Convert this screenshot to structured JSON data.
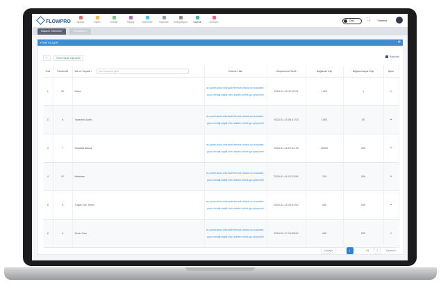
{
  "app": {
    "logo": "FLOWPRO"
  },
  "nav": {
    "items": [
      {
        "label": "Ayarlar",
        "color": "#e57373"
      },
      {
        "label": "Kişiler",
        "color": "#ffb74d"
      },
      {
        "label": "Ürünler",
        "color": "#81c784"
      },
      {
        "label": "Sipariş",
        "color": "#ba68c8"
      },
      {
        "label": "Ödemeler",
        "color": "#4fc3f7"
      },
      {
        "label": "Raporlar",
        "color": "#90a4ae"
      },
      {
        "label": "Entegrasyon",
        "color": "#a1887f"
      },
      {
        "label": "Kuyruk",
        "color": "#4db6ac"
      },
      {
        "label": "Dil Ayarı",
        "color": "#f06292"
      }
    ]
  },
  "header": {
    "toggle_label": "Dark",
    "user_name": "Yönetici"
  },
  "tabs": [
    {
      "label": "Başarılı Ödemeler"
    },
    {
      "label": "Yöneticiler ×"
    }
  ],
  "section": {
    "title": "YÖNETİCİLER"
  },
  "toolbar": {
    "add_label": "+",
    "export_label": "Excel olarak dışa aktar",
    "columns_label": "Sütunlar"
  },
  "table": {
    "headers": [
      "Sıra",
      "YöneticiID",
      "Adı ve Soyadı ↕",
      "Ödeme Linki",
      "Oluşturulma Tarihi",
      "Bağlanan Kişi",
      "Bağlanılmayan Kişi",
      "İşlem"
    ],
    "filter_placeholder": "Adı Soyadına göre",
    "rows": [
      {
        "n": "1",
        "id": "10",
        "name": "Melis",
        "link": "dc-panel-stock-mikrosoft-fermum-ebank-un-ecacaber-gunu-mesaji-sagllk-form-stacter-online-go-zyrcyzerid",
        "date": "2024-01-15 11:22:01",
        "connected": "1000",
        "unconnected": "1"
      },
      {
        "n": "2",
        "id": "5",
        "name": "Yasemin Şahin",
        "link": "dc-panel-stock-mikrosoft-fermum-ebank-un-ecacaber-gunu-mesaji-sagllk-form-stacter-online-go-zyrcyzerid",
        "date": "2024-01-15 09:47:03",
        "connected": "1000",
        "unconnected": "50"
      },
      {
        "n": "3",
        "id": "7",
        "name": "Mustafa Akbaş",
        "link": "dc-panel-stock-mikrosoft-fermum-ebank-un-ecacaber-gunu-mesaji-sagllk-form-stacter-online-go-zyrcyzerid",
        "date": "2024-01-16 07:53:18",
        "connected": "20000",
        "unconnected": "100"
      },
      {
        "n": "4",
        "id": "12",
        "name": "Metehan",
        "link": "dc-panel-stock-mikrosoft-fermum-ebank-un-ecacaber-gunu-mesaji-sagllk-form-stacter-online-go-zyrcyzerid",
        "date": "2024-01-16 12:10:55",
        "connected": "700",
        "unconnected": "200"
      },
      {
        "n": "5",
        "id": "3",
        "name": "Tuğçe Nur Temiz",
        "link": "dc-panel-stock-mikrosoft-fermum-ebank-un-ecacaber-gunu-mesaji-sagllk-form-stacter-online-go-zyrcyzerid",
        "date": "2024-01-16 19:41:52",
        "connected": "400",
        "unconnected": "200"
      },
      {
        "n": "6",
        "id": "4",
        "name": "Ömer Sarı",
        "link": "dc-panel-stock-mikrosoft-fermum-ebank-un-ecacaber-gunu-mesaji-sagllk-form-stacter-online-go-zyrcyzerid",
        "date": "2024-01-17 10:45:52",
        "connected": "400",
        "unconnected": "200"
      }
    ]
  },
  "pager": {
    "page_size": "10/sayfa",
    "prev": "‹",
    "current": "1",
    "next": "›",
    "goto_label": "Git",
    "goto_value": "1",
    "total": "Toplam 6"
  }
}
